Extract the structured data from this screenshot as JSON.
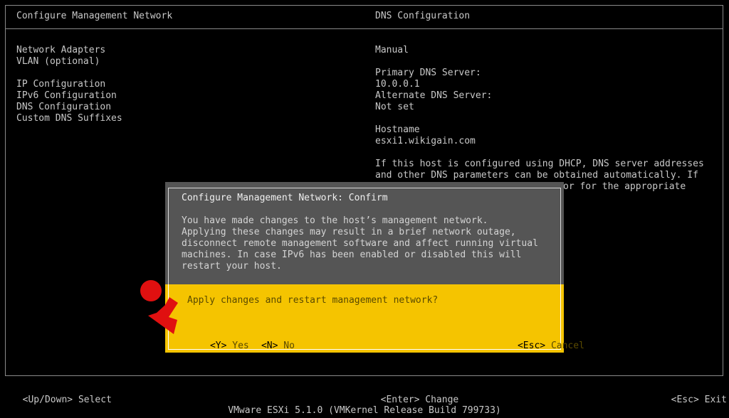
{
  "header": {
    "title": "Configure Management Network",
    "right_title": "DNS Configuration"
  },
  "menu": {
    "items": [
      "Network Adapters",
      "VLAN (optional)",
      "",
      "IP Configuration",
      "IPv6 Configuration",
      "DNS Configuration",
      "Custom DNS Suffixes"
    ]
  },
  "details": {
    "mode": "Manual",
    "primary_label": "Primary DNS Server:",
    "primary_value": "10.0.0.1",
    "alternate_label": "Alternate DNS Server:",
    "alternate_value": "Not set",
    "hostname_label": "Hostname",
    "hostname_value": "esxi1.wikigain.com",
    "help_line1": "If this host is configured using DHCP, DNS server addresses",
    "help_line2": "and other DNS parameters can be obtained automatically. If",
    "help_line3": "or for the appropriate"
  },
  "dialog": {
    "title": "Configure Management Network: Confirm",
    "message_lines": [
      "You have made changes to the host’s management network.",
      "Applying these changes may result in a brief network outage,",
      "disconnect remote management software and affect running virtual",
      "machines. In case IPv6 has been enabled or disabled this will",
      "restart your host."
    ],
    "question": "Apply changes and restart management network?",
    "yes_key": "<Y>",
    "yes_label": "Yes",
    "no_key": "<N>",
    "no_label": "No",
    "cancel_key": "<Esc>",
    "cancel_label": "Cancel"
  },
  "footer": {
    "select_key": "<Up/Down>",
    "select_label": "Select",
    "change_key": "<Enter>",
    "change_label": "Change",
    "exit_key": "<Esc>",
    "exit_label": "Exit",
    "version": "VMware ESXi 5.1.0 (VMKernel Release Build 799733)"
  },
  "colors": {
    "background": "#000000",
    "dialog_gray": "#555555",
    "dialog_yellow": "#f5c400",
    "marker_red": "#e01010"
  }
}
